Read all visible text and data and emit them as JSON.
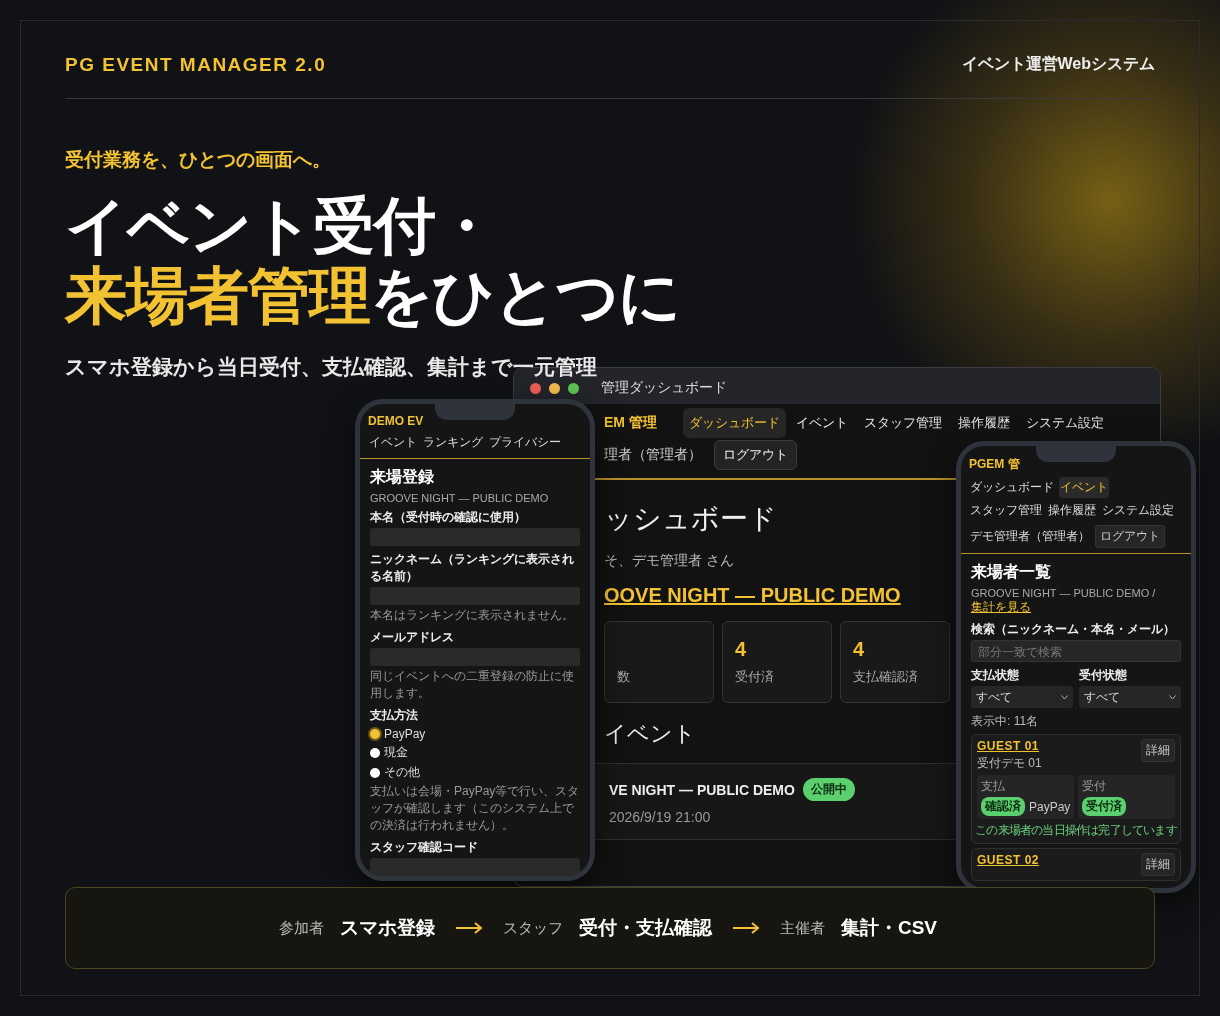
{
  "header": {
    "brand": "PG EVENT MANAGER 2.0",
    "tagline": "イベント運営Webシステム"
  },
  "hero": {
    "kicker": "受付業務を、ひとつの画面へ。",
    "headline_line1": "イベント受付・",
    "headline_highlight": "来場者管理",
    "headline_rest": "をひとつに",
    "subtitle": "スマホ登録から当日受付、支払確認、集計まで一元管理"
  },
  "dashboard_window": {
    "title": "管理ダッシュボード",
    "brand": "EM 管理",
    "nav": [
      {
        "label": "ダッシュボード",
        "selected": true
      },
      {
        "label": "イベント",
        "selected": false
      },
      {
        "label": "スタッフ管理",
        "selected": false
      },
      {
        "label": "操作履歴",
        "selected": false
      },
      {
        "label": "システム設定",
        "selected": false
      }
    ],
    "user": "理者（管理者）",
    "logout": "ログアウト",
    "heading": "ッシュボード",
    "welcome": "そ、デモ管理者 さん",
    "event_link": "OOVE NIGHT — PUBLIC DEMO",
    "stats": [
      {
        "label": "数"
      },
      {
        "value": "4",
        "label": "受付済"
      },
      {
        "value": "4",
        "label": "支払確認済"
      }
    ],
    "section_heading": "イベント",
    "events": [
      {
        "name": "VE NIGHT — PUBLIC DEMO",
        "status": "公開中",
        "date": "2026/9/19 21:00"
      }
    ]
  },
  "registration_phone": {
    "brand": "DEMO EV",
    "nav": [
      "イベント",
      "ランキング",
      "プライバシー"
    ],
    "title": "来場登録",
    "event": "GROOVE NIGHT — PUBLIC DEMO",
    "fields": [
      {
        "label": "本名（受付時の確認に使用）"
      },
      {
        "label": "ニックネーム（ランキングに表示される名前）",
        "hint": "本名はランキングに表示されません。"
      },
      {
        "label": "メールアドレス",
        "hint": "同じイベントへの二重登録の防止に使用します。"
      }
    ],
    "payment": {
      "label": "支払方法",
      "options": [
        {
          "label": "PayPay",
          "selected": true
        },
        {
          "label": "現金",
          "selected": false
        },
        {
          "label": "その他",
          "selected": false
        }
      ],
      "note": "支払いは会場・PayPay等で行い、スタッフが確認します（このシステム上での決済は行われません）。"
    },
    "staff_code_label": "スタッフ確認コード"
  },
  "attendee_phone": {
    "brand": "PGEM 管",
    "nav": [
      {
        "label": "ダッシュボード",
        "selected": false
      },
      {
        "label": "イベント",
        "selected": true
      },
      {
        "label": "スタッフ管理",
        "selected": false
      },
      {
        "label": "操作履歴",
        "selected": false
      },
      {
        "label": "システム設定",
        "selected": false
      }
    ],
    "user": "デモ管理者（管理者）",
    "logout": "ログアウト",
    "title": "来場者一覧",
    "event": "GROOVE NIGHT — PUBLIC DEMO /",
    "summary_link": "集計を見る",
    "search": {
      "label": "検索（ニックネーム・本名・メール）",
      "placeholder": "部分一致で検索"
    },
    "filters": [
      {
        "label": "支払状態",
        "value": "すべて"
      },
      {
        "label": "受付状態",
        "value": "すべて"
      }
    ],
    "count": "表示中: 11名",
    "guests": [
      {
        "name": "GUEST 01",
        "sub": "受付デモ 01",
        "detail": "詳細",
        "payment": {
          "label": "支払",
          "badge": "確認済",
          "method": "PayPay"
        },
        "checkin": {
          "label": "受付",
          "badge": "受付済"
        },
        "note": "この来場者の当日操作は完了しています"
      },
      {
        "name": "GUEST 02",
        "detail": "詳細"
      }
    ]
  },
  "flow": [
    {
      "role": "参加者",
      "action": "スマホ登録"
    },
    {
      "role": "スタッフ",
      "action": "受付・支払確認"
    },
    {
      "role": "主催者",
      "action": "集計・CSV"
    }
  ]
}
